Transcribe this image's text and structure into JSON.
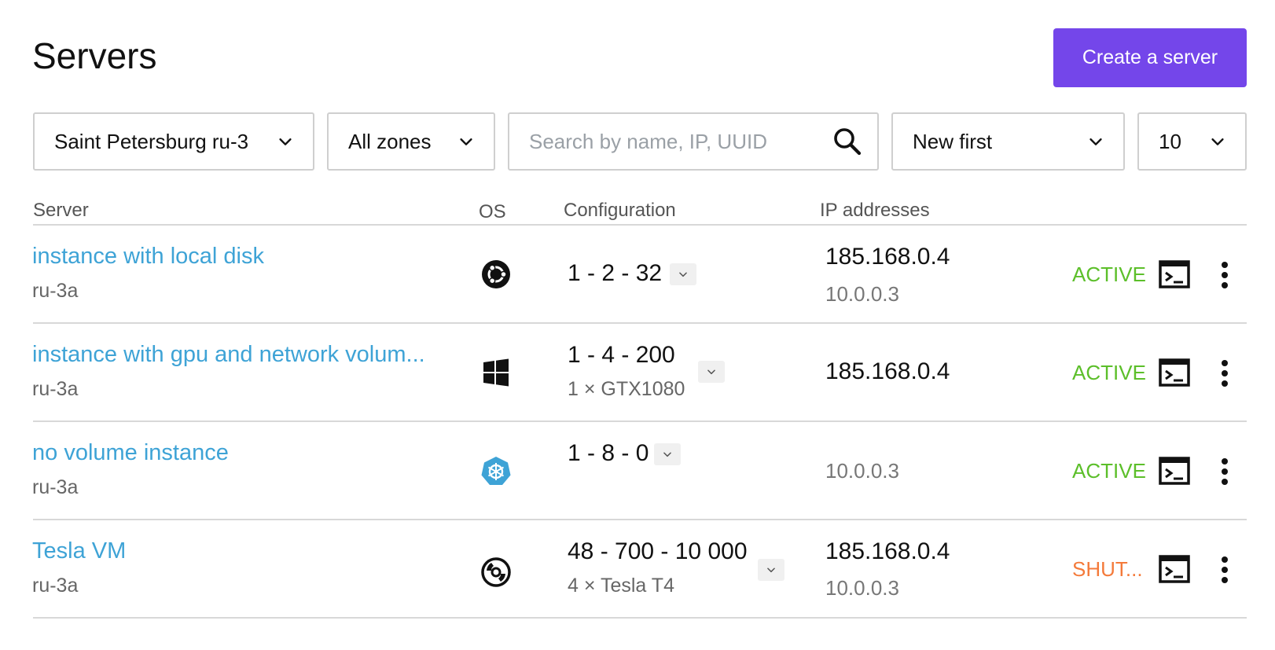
{
  "header": {
    "title": "Servers",
    "create_label": "Create a server"
  },
  "filters": {
    "region": "Saint Petersburg ru-3",
    "zone": "All zones",
    "search_placeholder": "Search by name, IP, UUID",
    "sort": "New first",
    "page_size": "10"
  },
  "table": {
    "headers": [
      "Server",
      "OS",
      "Configuration",
      "IP addresses"
    ],
    "rows": [
      {
        "name": "instance with local disk",
        "zone": "ru-3a",
        "os_icon": "ubuntu-icon",
        "config": "1 - 2 - 32",
        "config_sub": "",
        "ip_public": "185.168.0.4",
        "ip_private": "10.0.0.3",
        "status": "ACTIVE",
        "status_color": "#5cbf2a"
      },
      {
        "name": "instance with gpu and network volum...",
        "zone": "ru-3a",
        "os_icon": "windows-icon",
        "config": "1 - 4 - 200",
        "config_sub": "1 × GTX1080",
        "ip_public": "185.168.0.4",
        "ip_private": "",
        "status": "ACTIVE",
        "status_color": "#5cbf2a"
      },
      {
        "name": "no volume instance",
        "zone": "ru-3a",
        "os_icon": "kubernetes-icon",
        "config": "1 - 8 - 0",
        "config_sub": "",
        "ip_public": "",
        "ip_private": "10.0.0.3",
        "status": "ACTIVE",
        "status_color": "#5cbf2a"
      },
      {
        "name": "Tesla VM",
        "zone": "ru-3a",
        "os_icon": "disk-image-icon",
        "config": "48 - 700 - 10 000",
        "config_sub": "4 × Tesla T4",
        "ip_public": "185.168.0.4",
        "ip_private": "10.0.0.3",
        "status": "SHUT...",
        "status_color": "#f47a3a"
      }
    ]
  },
  "colors": {
    "accent": "#7446ea",
    "link": "#3ea3d6",
    "active": "#5cbf2a",
    "shutoff": "#f47a3a"
  }
}
